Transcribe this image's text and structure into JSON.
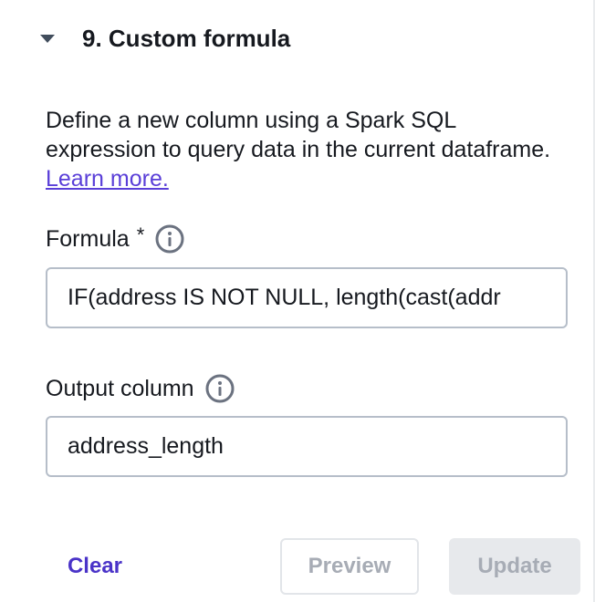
{
  "section": {
    "title": "9. Custom formula",
    "expanded": true
  },
  "description": {
    "text": "Define a new column using a Spark SQL expression to query data in the current dataframe.",
    "link_label": "Learn more."
  },
  "formula": {
    "label": "Formula",
    "required_marker": "*",
    "value": "IF(address IS NOT NULL, length(cast(addr"
  },
  "output_column": {
    "label": "Output column",
    "value": "address_length"
  },
  "buttons": {
    "clear": "Clear",
    "preview": "Preview",
    "update": "Update"
  },
  "colors": {
    "accent": "#4a33c8",
    "link": "#5a3fd8",
    "disabled_text": "#a7acb5",
    "input_border": "#b6bec9"
  },
  "icons": [
    "caret-down-icon",
    "info-icon"
  ]
}
